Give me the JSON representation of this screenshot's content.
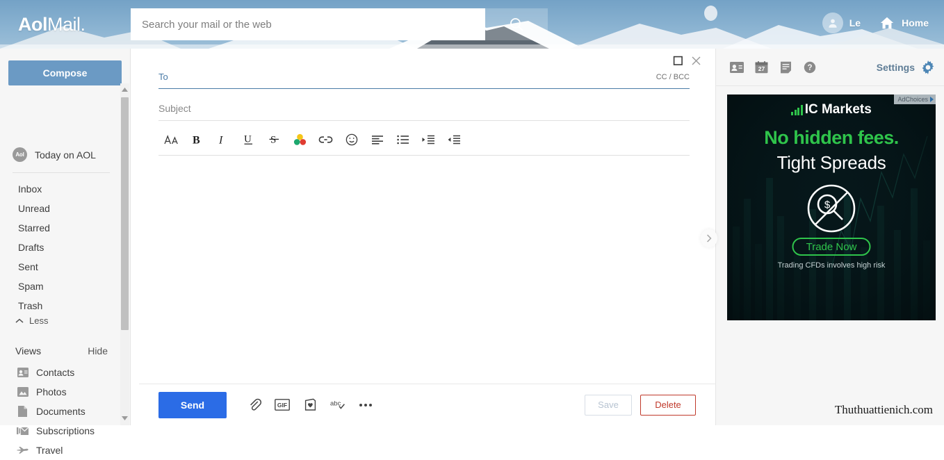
{
  "header": {
    "logo_bold": "Aol",
    "logo_light": "Mail.",
    "search_placeholder": "Search your mail or the web",
    "search_value": "",
    "search_icon": "search-icon",
    "user_name": "Le",
    "home_label": "Home",
    "avatar_icon": "user-avatar-icon",
    "home_icon": "home-icon"
  },
  "sidebar": {
    "compose_label": "Compose",
    "today_label": "Today on AOL",
    "today_badge": "Aol",
    "folders": [
      {
        "label": "Inbox"
      },
      {
        "label": "Unread"
      },
      {
        "label": "Starred"
      },
      {
        "label": "Drafts"
      },
      {
        "label": "Sent"
      },
      {
        "label": "Spam"
      },
      {
        "label": "Trash"
      }
    ],
    "less_label": "Less",
    "less_icon": "chevron-up-icon",
    "views_label": "Views",
    "views_hide_label": "Hide",
    "views": [
      {
        "label": "Contacts",
        "icon": "contacts-icon"
      },
      {
        "label": "Photos",
        "icon": "photos-icon"
      },
      {
        "label": "Documents",
        "icon": "document-icon"
      },
      {
        "label": "Subscriptions",
        "icon": "subscriptions-icon"
      },
      {
        "label": "Travel",
        "icon": "travel-plane-icon"
      }
    ],
    "scrollbar_up_icon": "scroll-up-arrow-icon",
    "scrollbar_down_icon": "scroll-down-arrow-icon"
  },
  "compose": {
    "maximize_icon": "maximize-icon",
    "close_icon": "close-icon",
    "to_label": "To",
    "to_value": "",
    "to_placeholder": "",
    "cc_bcc_label": "CC / BCC",
    "subject_placeholder": "Subject",
    "subject_value": "",
    "body_value": "",
    "body_placeholder": "",
    "expand_icon": "chevron-right-icon",
    "toolbar": [
      {
        "name": "font-size-icon",
        "title": "Font size"
      },
      {
        "name": "bold-icon",
        "title": "Bold"
      },
      {
        "name": "italic-icon",
        "title": "Italic"
      },
      {
        "name": "underline-icon",
        "title": "Underline"
      },
      {
        "name": "strikethrough-icon",
        "title": "Strikethrough"
      },
      {
        "name": "text-color-icon",
        "title": "Text color"
      },
      {
        "name": "link-icon",
        "title": "Insert link"
      },
      {
        "name": "emoji-icon",
        "title": "Emoji"
      },
      {
        "name": "align-icon",
        "title": "Align"
      },
      {
        "name": "bulleted-list-icon",
        "title": "Bulleted list"
      },
      {
        "name": "indent-icon",
        "title": "Indent"
      },
      {
        "name": "outdent-icon",
        "title": "Outdent"
      }
    ],
    "send_label": "Send",
    "actions": [
      {
        "name": "attach-file-icon",
        "title": "Attach file"
      },
      {
        "name": "gif-icon",
        "title": "Insert GIF"
      },
      {
        "name": "greeting-card-icon",
        "title": "Greeting card"
      },
      {
        "name": "spellcheck-icon",
        "title": "Spell check"
      },
      {
        "name": "more-options-icon",
        "title": "More options"
      }
    ],
    "save_label": "Save",
    "delete_label": "Delete"
  },
  "rail": {
    "icons": [
      {
        "name": "contacts-panel-icon",
        "title": "Contacts"
      },
      {
        "name": "calendar-icon",
        "title": "Calendar",
        "day": "27"
      },
      {
        "name": "notepad-icon",
        "title": "Notepad"
      },
      {
        "name": "help-icon",
        "title": "Help"
      }
    ],
    "settings_label": "Settings",
    "settings_icon": "gear-icon"
  },
  "ad": {
    "adchoices_label": "AdChoices",
    "brand": "IC Markets",
    "headline": "No hidden fees.",
    "subhead": "Tight Spreads",
    "cta_label": "Trade Now",
    "disclaimer": "Trading CFDs involves high risk",
    "emblem_icon": "no-fees-magnifier-icon",
    "accent_color": "#2fc44b",
    "bg_color": "#06171a"
  },
  "watermark": {
    "text": "Thuthuattienich.com"
  },
  "colors": {
    "compose_button": "#6b9ac4",
    "send_button": "#2b6ce6",
    "delete_accent": "#c0392b",
    "to_underline": "#4a7ba7",
    "settings_text": "#5f7d96"
  }
}
